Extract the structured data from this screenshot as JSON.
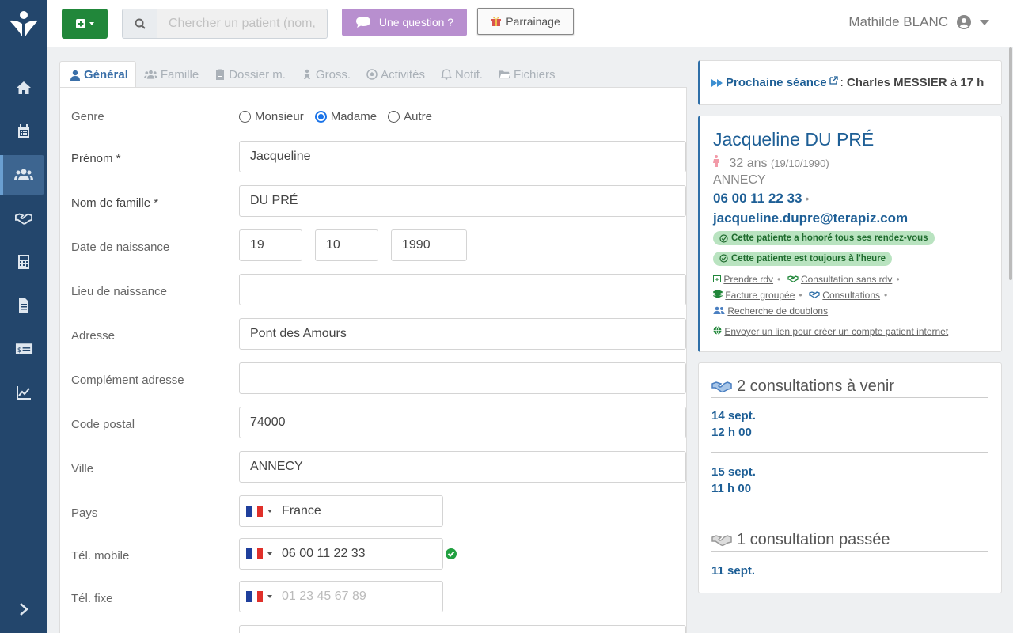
{
  "header": {
    "search_placeholder": "Chercher un patient (nom,",
    "question_label": "Une question ?",
    "referral_label": "Parrainage",
    "user_name": "Mathilde BLANC"
  },
  "tabs": [
    {
      "label": "Général",
      "icon": "user-icon",
      "active": true
    },
    {
      "label": "Famille",
      "icon": "users-icon"
    },
    {
      "label": "Dossier m.",
      "icon": "clipboard-icon"
    },
    {
      "label": "Gross.",
      "icon": "baby-icon"
    },
    {
      "label": "Activités",
      "icon": "soccer-ball-icon"
    },
    {
      "label": "Notif.",
      "icon": "bell-icon"
    },
    {
      "label": "Fichiers",
      "icon": "folder-icon"
    }
  ],
  "form": {
    "genre": {
      "label": "Genre",
      "options": [
        "Monsieur",
        "Madame",
        "Autre"
      ],
      "selected": "Madame"
    },
    "prenom": {
      "label": "Prénom *",
      "value": "Jacqueline"
    },
    "nom": {
      "label": "Nom de famille *",
      "value": "DU PRÉ"
    },
    "naissance": {
      "label": "Date de naissance",
      "day": "19",
      "month": "10",
      "year": "1990"
    },
    "lieu": {
      "label": "Lieu de naissance",
      "value": ""
    },
    "adresse": {
      "label": "Adresse",
      "value": "Pont des Amours"
    },
    "complement": {
      "label": "Complément adresse",
      "value": ""
    },
    "code_postal": {
      "label": "Code postal",
      "value": "74000"
    },
    "ville": {
      "label": "Ville",
      "value": "ANNECY"
    },
    "pays": {
      "label": "Pays",
      "value": "France"
    },
    "mobile": {
      "label": "Tél. mobile",
      "value": "06 00 11 22 33"
    },
    "fixe": {
      "label": "Tél. fixe",
      "placeholder": "01 23 45 67 89"
    }
  },
  "next_session": {
    "label": "Prochaine séance",
    "separator": ":",
    "name": "Charles MESSIER",
    "at": "à",
    "time": "17 h"
  },
  "patient": {
    "name": "Jacqueline DU PRÉ",
    "age": "32 ans",
    "birthdate": "(19/10/1990)",
    "city": "ANNECY",
    "phone": "06 00 11 22 33",
    "email": "jacqueline.dupre@terapiz.com",
    "badges": [
      "Cette patiente a honoré tous ses rendez-vous",
      "Cette patiente est toujours à l'heure"
    ],
    "links": {
      "rdv": "Prendre rdv",
      "sans_rdv": "Consultation sans rdv",
      "facture": "Facture groupée",
      "consultations": "Consultations",
      "doublons": "Recherche de doublons",
      "compte": "Envoyer un lien pour créer un compte patient internet"
    }
  },
  "consultations": {
    "upcoming_title": "2 consultations à venir",
    "upcoming": [
      {
        "date": "14 sept.",
        "time": "12 h 00"
      },
      {
        "date": "15 sept.",
        "time": "11 h 00"
      }
    ],
    "past_title": "1 consultation passée",
    "past": [
      {
        "date": "11 sept."
      }
    ]
  },
  "colors": {
    "sidebar": "#23466c",
    "primary": "#1e5f96",
    "success": "#21873a",
    "question": "#b88fcf"
  }
}
